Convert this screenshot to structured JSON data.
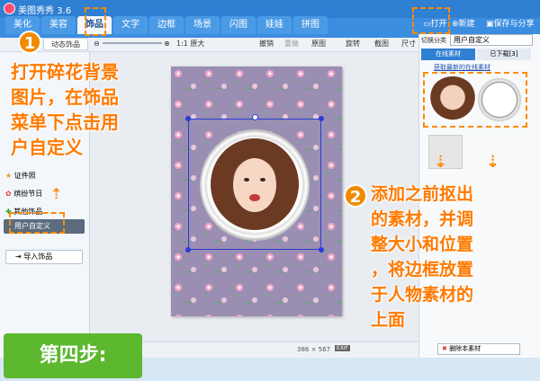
{
  "app": {
    "title": "美图秀秀 3.6"
  },
  "tabs": [
    {
      "label": "美化"
    },
    {
      "label": "美容"
    },
    {
      "label": "饰品"
    },
    {
      "label": "文字"
    },
    {
      "label": "边框"
    },
    {
      "label": "场景"
    },
    {
      "label": "闪图"
    },
    {
      "label": "娃娃"
    },
    {
      "label": "拼图"
    }
  ],
  "top_actions": {
    "open": "打开",
    "new": "新建",
    "save_share": "保存与分享"
  },
  "toolbar": {
    "left_tab": "动态饰品",
    "original_size": "1:1 原大",
    "undo": "撤销",
    "redo": "重做",
    "original": "原图",
    "rotate": "旋转",
    "crop": "截图",
    "size": "尺寸"
  },
  "left_panel": {
    "items": [
      {
        "label": "证件照"
      },
      {
        "label": "缤纷节日"
      },
      {
        "label": "其他饰品"
      },
      {
        "label": "用户自定义"
      }
    ],
    "import_button": "导入饰品"
  },
  "right_panel": {
    "switch_label": "切换分类",
    "category_value": "用户自定义",
    "tab_online": "在线素材",
    "tab_downloaded": "已下载[3]",
    "fetch_link": "获取最新的在线素材",
    "delete_button": "删除本素材"
  },
  "status": {
    "dimensions": "386 × 567",
    "exif": "EXIF"
  },
  "annotations": {
    "badge1": "1",
    "badge2": "2",
    "note1": [
      "打开碎花背景",
      "图片，在饰品",
      "菜单下点击用",
      "户自定义"
    ],
    "note2": [
      "添加之前抠出",
      "的素材，并调",
      "整大小和位置",
      "，将边框放置",
      "于人物素材的",
      "上面"
    ],
    "step": "第四步:"
  },
  "colors": {
    "accent": "#ff8a00",
    "brand_blue": "#2f7fd3",
    "step_green": "#5cb82e"
  }
}
